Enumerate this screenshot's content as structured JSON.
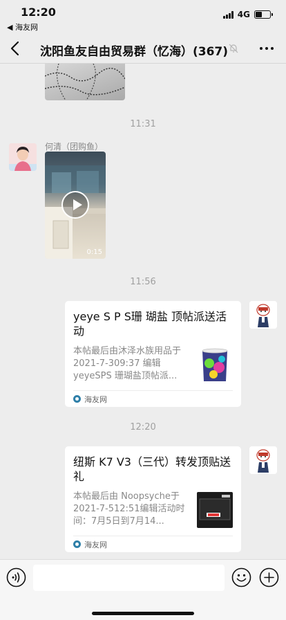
{
  "status_bar": {
    "time": "12:20",
    "back_app": "◀ 海友网",
    "network": "4G",
    "battery_level": 0.45
  },
  "header": {
    "title": "沈阳鱼友自由贸易群（忆海）(367)",
    "icons": [
      "back-arrow-icon",
      "mute-bell-icon",
      "more-dots-icon"
    ]
  },
  "messages": [
    {
      "type": "time",
      "text": "11:31"
    },
    {
      "type": "video",
      "sender": "何清（团购鱼）",
      "duration": "0:15",
      "side": "left"
    },
    {
      "type": "time",
      "text": "11:56"
    },
    {
      "type": "link_card",
      "side": "right",
      "title": "yeye S P S珊 瑚盐 顶帖派送活动",
      "description": "本帖最后由沐泽水族用品于 2021-7-309:37 编辑 yeyeSPS 珊瑚盐顶帖派...",
      "source": "海友网"
    },
    {
      "type": "time",
      "text": "12:20"
    },
    {
      "type": "link_card",
      "side": "right",
      "title": "纽斯 K7 V3（三代）转发顶贴送礼",
      "description": "本帖最后由 Noopsyche于 2021-7-512:51编辑活动时间：7月5日到7月14...",
      "source": "海友网"
    }
  ],
  "input_bar": {
    "icons": [
      "voice-icon",
      "emoji-icon",
      "plus-icon"
    ]
  },
  "colors": {
    "background": "#ededed",
    "card": "#ffffff",
    "muted_text": "#888888"
  }
}
